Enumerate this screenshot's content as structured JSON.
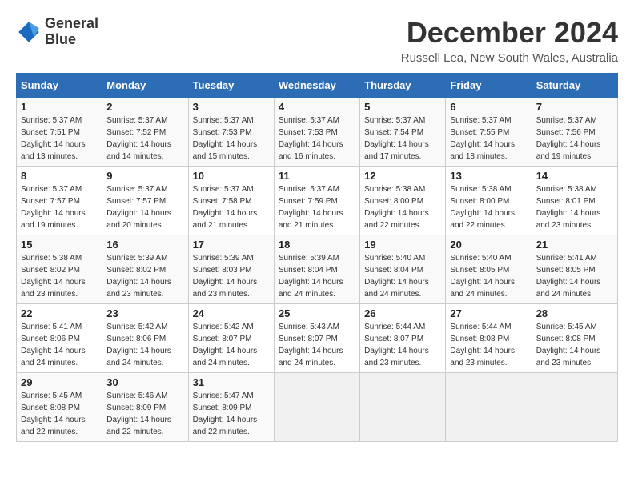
{
  "header": {
    "logo_line1": "General",
    "logo_line2": "Blue",
    "month_title": "December 2024",
    "location": "Russell Lea, New South Wales, Australia"
  },
  "calendar": {
    "columns": [
      "Sunday",
      "Monday",
      "Tuesday",
      "Wednesday",
      "Thursday",
      "Friday",
      "Saturday"
    ],
    "weeks": [
      [
        null,
        {
          "day": "2",
          "sunrise": "Sunrise: 5:37 AM",
          "sunset": "Sunset: 7:52 PM",
          "daylight": "Daylight: 14 hours and 14 minutes."
        },
        {
          "day": "3",
          "sunrise": "Sunrise: 5:37 AM",
          "sunset": "Sunset: 7:53 PM",
          "daylight": "Daylight: 14 hours and 15 minutes."
        },
        {
          "day": "4",
          "sunrise": "Sunrise: 5:37 AM",
          "sunset": "Sunset: 7:53 PM",
          "daylight": "Daylight: 14 hours and 16 minutes."
        },
        {
          "day": "5",
          "sunrise": "Sunrise: 5:37 AM",
          "sunset": "Sunset: 7:54 PM",
          "daylight": "Daylight: 14 hours and 17 minutes."
        },
        {
          "day": "6",
          "sunrise": "Sunrise: 5:37 AM",
          "sunset": "Sunset: 7:55 PM",
          "daylight": "Daylight: 14 hours and 18 minutes."
        },
        {
          "day": "7",
          "sunrise": "Sunrise: 5:37 AM",
          "sunset": "Sunset: 7:56 PM",
          "daylight": "Daylight: 14 hours and 19 minutes."
        }
      ],
      [
        {
          "day": "1",
          "sunrise": "Sunrise: 5:37 AM",
          "sunset": "Sunset: 7:51 PM",
          "daylight": "Daylight: 14 hours and 13 minutes."
        },
        {
          "day": "9",
          "sunrise": "Sunrise: 5:37 AM",
          "sunset": "Sunset: 7:57 PM",
          "daylight": "Daylight: 14 hours and 20 minutes."
        },
        {
          "day": "10",
          "sunrise": "Sunrise: 5:37 AM",
          "sunset": "Sunset: 7:58 PM",
          "daylight": "Daylight: 14 hours and 21 minutes."
        },
        {
          "day": "11",
          "sunrise": "Sunrise: 5:37 AM",
          "sunset": "Sunset: 7:59 PM",
          "daylight": "Daylight: 14 hours and 21 minutes."
        },
        {
          "day": "12",
          "sunrise": "Sunrise: 5:38 AM",
          "sunset": "Sunset: 8:00 PM",
          "daylight": "Daylight: 14 hours and 22 minutes."
        },
        {
          "day": "13",
          "sunrise": "Sunrise: 5:38 AM",
          "sunset": "Sunset: 8:00 PM",
          "daylight": "Daylight: 14 hours and 22 minutes."
        },
        {
          "day": "14",
          "sunrise": "Sunrise: 5:38 AM",
          "sunset": "Sunset: 8:01 PM",
          "daylight": "Daylight: 14 hours and 23 minutes."
        }
      ],
      [
        {
          "day": "8",
          "sunrise": "Sunrise: 5:37 AM",
          "sunset": "Sunset: 7:57 PM",
          "daylight": "Daylight: 14 hours and 19 minutes."
        },
        {
          "day": "16",
          "sunrise": "Sunrise: 5:39 AM",
          "sunset": "Sunset: 8:02 PM",
          "daylight": "Daylight: 14 hours and 23 minutes."
        },
        {
          "day": "17",
          "sunrise": "Sunrise: 5:39 AM",
          "sunset": "Sunset: 8:03 PM",
          "daylight": "Daylight: 14 hours and 23 minutes."
        },
        {
          "day": "18",
          "sunrise": "Sunrise: 5:39 AM",
          "sunset": "Sunset: 8:04 PM",
          "daylight": "Daylight: 14 hours and 24 minutes."
        },
        {
          "day": "19",
          "sunrise": "Sunrise: 5:40 AM",
          "sunset": "Sunset: 8:04 PM",
          "daylight": "Daylight: 14 hours and 24 minutes."
        },
        {
          "day": "20",
          "sunrise": "Sunrise: 5:40 AM",
          "sunset": "Sunset: 8:05 PM",
          "daylight": "Daylight: 14 hours and 24 minutes."
        },
        {
          "day": "21",
          "sunrise": "Sunrise: 5:41 AM",
          "sunset": "Sunset: 8:05 PM",
          "daylight": "Daylight: 14 hours and 24 minutes."
        }
      ],
      [
        {
          "day": "15",
          "sunrise": "Sunrise: 5:38 AM",
          "sunset": "Sunset: 8:02 PM",
          "daylight": "Daylight: 14 hours and 23 minutes."
        },
        {
          "day": "23",
          "sunrise": "Sunrise: 5:42 AM",
          "sunset": "Sunset: 8:06 PM",
          "daylight": "Daylight: 14 hours and 24 minutes."
        },
        {
          "day": "24",
          "sunrise": "Sunrise: 5:42 AM",
          "sunset": "Sunset: 8:07 PM",
          "daylight": "Daylight: 14 hours and 24 minutes."
        },
        {
          "day": "25",
          "sunrise": "Sunrise: 5:43 AM",
          "sunset": "Sunset: 8:07 PM",
          "daylight": "Daylight: 14 hours and 24 minutes."
        },
        {
          "day": "26",
          "sunrise": "Sunrise: 5:44 AM",
          "sunset": "Sunset: 8:07 PM",
          "daylight": "Daylight: 14 hours and 23 minutes."
        },
        {
          "day": "27",
          "sunrise": "Sunrise: 5:44 AM",
          "sunset": "Sunset: 8:08 PM",
          "daylight": "Daylight: 14 hours and 23 minutes."
        },
        {
          "day": "28",
          "sunrise": "Sunrise: 5:45 AM",
          "sunset": "Sunset: 8:08 PM",
          "daylight": "Daylight: 14 hours and 23 minutes."
        }
      ],
      [
        {
          "day": "22",
          "sunrise": "Sunrise: 5:41 AM",
          "sunset": "Sunset: 8:06 PM",
          "daylight": "Daylight: 14 hours and 24 minutes."
        },
        {
          "day": "30",
          "sunrise": "Sunrise: 5:46 AM",
          "sunset": "Sunset: 8:09 PM",
          "daylight": "Daylight: 14 hours and 22 minutes."
        },
        {
          "day": "31",
          "sunrise": "Sunrise: 5:47 AM",
          "sunset": "Sunset: 8:09 PM",
          "daylight": "Daylight: 14 hours and 22 minutes."
        },
        null,
        null,
        null,
        null
      ],
      [
        {
          "day": "29",
          "sunrise": "Sunrise: 5:45 AM",
          "sunset": "Sunset: 8:08 PM",
          "daylight": "Daylight: 14 hours and 22 minutes."
        },
        null,
        null,
        null,
        null,
        null,
        null
      ]
    ]
  }
}
